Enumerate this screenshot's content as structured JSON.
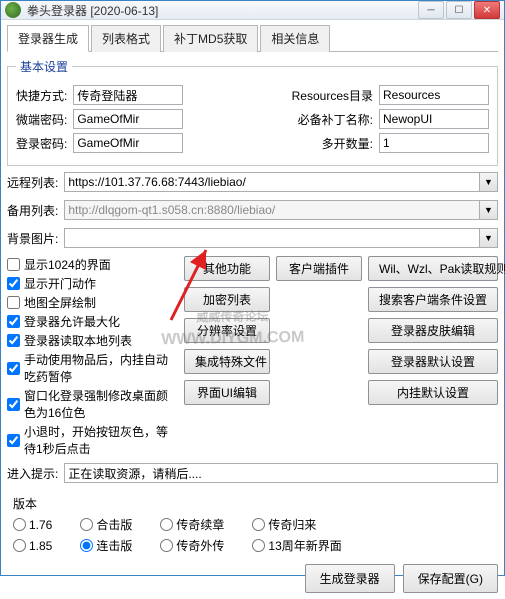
{
  "window": {
    "title": "拳头登录器 [2020-06-13]"
  },
  "tabs": [
    "登录器生成",
    "列表格式",
    "补丁MD5获取",
    "相关信息"
  ],
  "basic": {
    "legend": "基本设置",
    "shortcut_label": "快捷方式:",
    "shortcut_value": "传奇登陆器",
    "resdir_label": "Resources目录",
    "resdir_value": "Resources",
    "micro_label": "微端密码:",
    "micro_value": "GameOfMir",
    "patchname_label": "必备补丁名称:",
    "patchname_value": "NewopUI",
    "loginpwd_label": "登录密码:",
    "loginpwd_value": "GameOfMir",
    "multi_label": "多开数量:",
    "multi_value": "1"
  },
  "lists": {
    "remote_label": "远程列表:",
    "remote_value": "https://101.37.76.68:7443/liebiao/",
    "backup_label": "备用列表:",
    "backup_value": "http://dlqgom-qt1.s058.cn:8880/liebiao/",
    "bg_label": "背景图片:",
    "bg_value": ""
  },
  "checks": [
    {
      "label": "显示1024的界面",
      "checked": false
    },
    {
      "label": "显示开门动作",
      "checked": true
    },
    {
      "label": "地图全屏绘制",
      "checked": false
    },
    {
      "label": "登录器允许最大化",
      "checked": true
    },
    {
      "label": "登录器读取本地列表",
      "checked": true
    },
    {
      "label": "手动使用物品后，内挂自动吃药暂停",
      "checked": true
    },
    {
      "label": "窗口化登录强制修改桌面颜色为16位色",
      "checked": true
    },
    {
      "label": "小退时，开始按钮灰色，等待1秒后点击",
      "checked": true
    }
  ],
  "btncol1": [
    "其他功能",
    "加密列表",
    "分辨率设置",
    "集成特殊文件",
    "界面UI编辑"
  ],
  "btncol2_top": "客户端插件",
  "btncol2": [
    "Wil、Wzl、Pak读取规则",
    "搜索客户端条件设置",
    "登录器皮肤编辑",
    "登录器默认设置",
    "内挂默认设置"
  ],
  "enter": {
    "label": "进入提示:",
    "value": "正在读取资源，请稍后...."
  },
  "version": {
    "legend": "版本",
    "rowA": [
      "1.76",
      "合击版",
      "传奇续章",
      "传奇归来"
    ],
    "rowB": [
      "1.85",
      "连击版",
      "传奇外传",
      "13周年新界面"
    ],
    "selected": "连击版"
  },
  "bottom": {
    "gen": "生成登录器",
    "save": "保存配置(G)"
  },
  "watermark": {
    "line1": "威威传奇论坛",
    "line2": "WWW.DIYGM.COM"
  }
}
